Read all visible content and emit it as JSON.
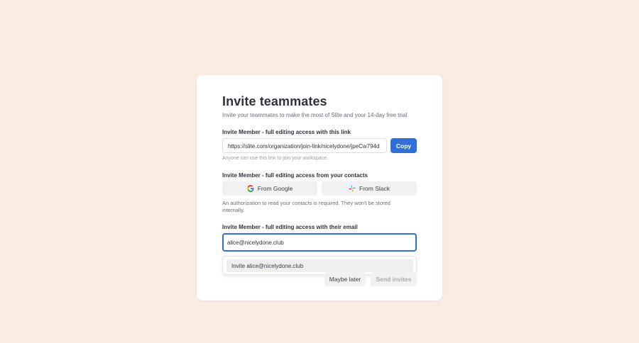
{
  "modal": {
    "title": "Invite teammates",
    "subtitle": "Invite your teammates to make the most of Slite and your 14-day free trial"
  },
  "link_section": {
    "label": "Invite Member - full editing access with this link",
    "link_value": "https://slite.com/organization/join-link/nicelydone/jpeCw794d",
    "copy_label": "Copy",
    "hint": "Anyone can use this link to join your workspace."
  },
  "contacts_section": {
    "label": "Invite Member - full editing access from your contacts",
    "google_label": "From Google",
    "slack_label": "From Slack",
    "note": "An authorization to read your contacts is required. They won't be stored internally."
  },
  "email_section": {
    "label": "Invite Member - full editing access with their email",
    "input_value": "alice@nicelydone.club",
    "suggestion": "Invite alice@nicelydone.club"
  },
  "footer": {
    "maybe_later_label": "Maybe later",
    "send_label": "Send invites"
  },
  "colors": {
    "background": "#f9ede3",
    "accent": "#2f6fd6"
  }
}
